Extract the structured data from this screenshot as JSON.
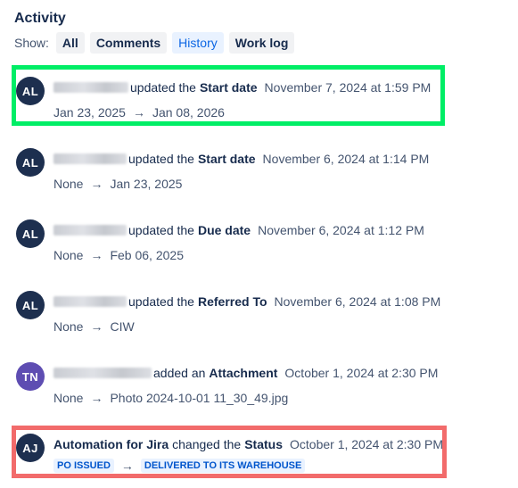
{
  "activity": {
    "title": "Activity"
  },
  "filters": {
    "label": "Show:",
    "buttons": [
      {
        "label": "All",
        "active": false
      },
      {
        "label": "Comments",
        "active": false
      },
      {
        "label": "History",
        "active": true
      },
      {
        "label": "Work log",
        "active": false
      }
    ]
  },
  "colors": {
    "highlight_green": "#00ee66",
    "highlight_red": "#f26b6b",
    "avatar_al": "#1d2f4f",
    "avatar_tn": "#5e4db2",
    "avatar_aj": "#1d2f4f",
    "lozenge_bg": "#e9f2ff",
    "lozenge_text": "#0055cc"
  },
  "entries": [
    {
      "avatar": "AL",
      "actor_blurred": true,
      "verb": "updated the",
      "field": "Start date",
      "time": "November 7, 2024 at 1:59 PM",
      "from": "Jan 23, 2025",
      "arrow": "→",
      "to": "Jan 08, 2026"
    },
    {
      "avatar": "AL",
      "actor_blurred": true,
      "verb": "updated the",
      "field": "Start date",
      "time": "November 6, 2024 at 1:14 PM",
      "from": "None",
      "arrow": "→",
      "to": "Jan 23, 2025"
    },
    {
      "avatar": "AL",
      "actor_blurred": true,
      "verb": "updated the",
      "field": "Due date",
      "time": "November 6, 2024 at 1:12 PM",
      "from": "None",
      "arrow": "→",
      "to": "Feb 06, 2025"
    },
    {
      "avatar": "AL",
      "actor_blurred": true,
      "verb": "updated the",
      "field": "Referred To",
      "time": "November 6, 2024 at 1:08 PM",
      "from": "None",
      "arrow": "→",
      "to": "CIW"
    },
    {
      "avatar": "TN",
      "actor_blurred": true,
      "verb": "added an",
      "field": "Attachment",
      "time": "October 1, 2024 at 2:30 PM",
      "from": "None",
      "arrow": "→",
      "to": "Photo 2024-10-01 11_30_49.jpg"
    },
    {
      "avatar": "AJ",
      "actor": "Automation for Jira",
      "verb": "changed the",
      "field": "Status",
      "time": "October 1, 2024 at 2:30 PM",
      "from": "PO ISSUED",
      "arrow": "→",
      "to": "DELIVERED TO ITS WAREHOUSE"
    }
  ]
}
